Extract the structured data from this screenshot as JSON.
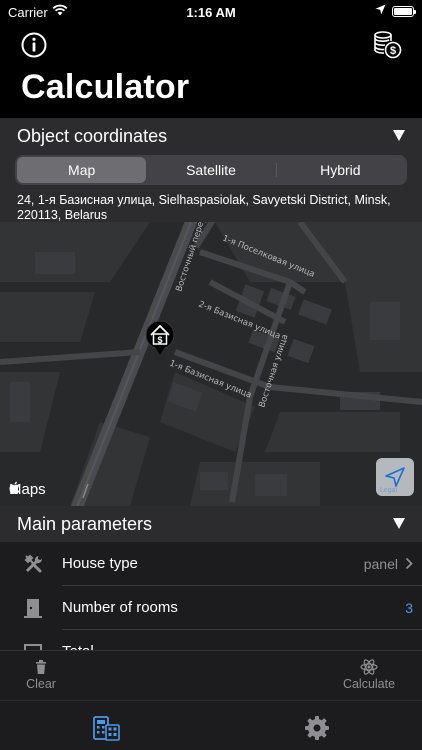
{
  "status_bar": {
    "carrier": "Carrier",
    "time": "1:16 AM"
  },
  "nav": {
    "title": "Calculator",
    "left_icon": "info-icon",
    "right_icon": "coins-dollar-icon"
  },
  "coordinates": {
    "header": "Object coordinates",
    "segments": [
      "Map",
      "Satellite",
      "Hybrid"
    ],
    "selected_segment": "Map",
    "address": "24, 1-я Базисная улица, Sielhaspasiolak, Savyetski District, Minsk, 220113, Belarus"
  },
  "map": {
    "streets": [
      "Восточный переулок",
      "1-я Поселковая улица",
      "2-я Базисная улица",
      "1-я Базисная улица",
      "Восточная улица"
    ],
    "attribution": "Maps",
    "legal": "Legal",
    "pin_icon": "house-dollar-pin-icon",
    "locate_icon": "location-arrow-icon"
  },
  "params": {
    "header": "Main parameters",
    "rows": [
      {
        "label": "House type",
        "value": "panel"
      },
      {
        "label": "Number of rooms",
        "value": "3"
      },
      {
        "label": "Total ...",
        "value": "..."
      }
    ]
  },
  "toolbar": {
    "clear": "Clear",
    "calculate": "Calculate"
  },
  "tabs": [
    "calculator-tab",
    "settings-tab"
  ],
  "colors": {
    "accent": "#4b97e8",
    "header_bg": "#2c2c2e",
    "row_bg": "#1c1c1e",
    "map_bg": "#28292b"
  }
}
